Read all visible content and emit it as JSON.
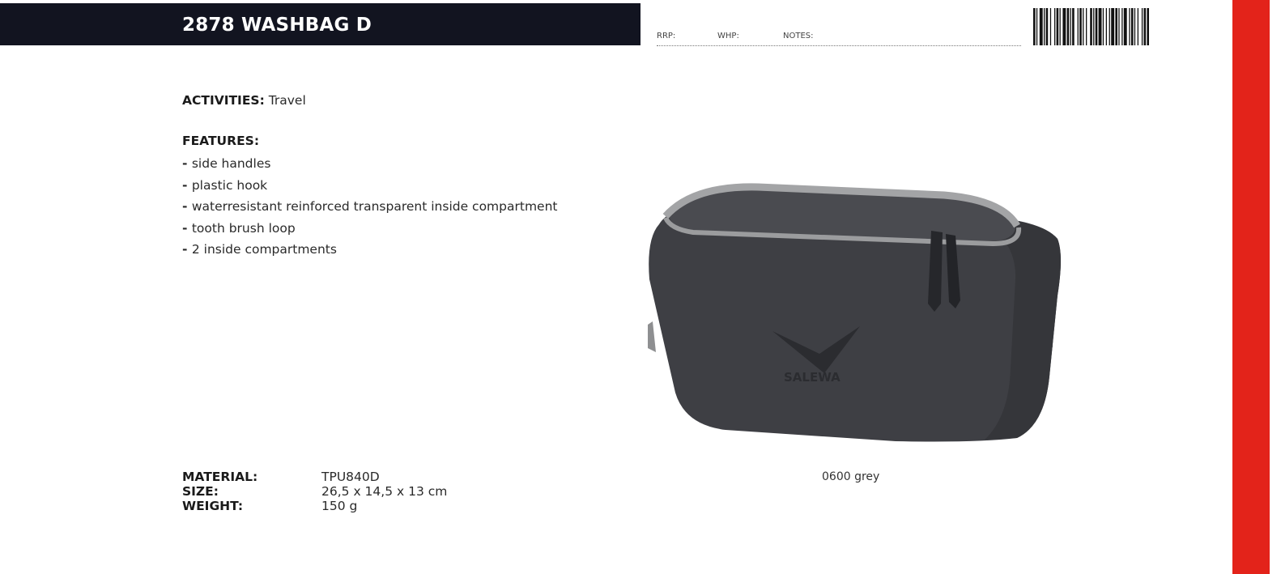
{
  "header": {
    "title": "2878 WASHBAG D"
  },
  "pricing": {
    "rrp_label": "RRP:",
    "whp_label": "WHP:",
    "notes_label": "NOTES:"
  },
  "activities": {
    "label": "ACTIVITIES:",
    "value": "Travel"
  },
  "features": {
    "label": "FEATURES:",
    "items": [
      "side handles",
      "plastic hook",
      "waterresistant reinforced transparent inside compartment",
      "tooth brush loop",
      "2 inside compartments"
    ]
  },
  "specs": {
    "material": {
      "label": "MATERIAL:",
      "value": "TPU840D"
    },
    "size": {
      "label": "SIZE:",
      "value": "26,5 x 14,5 x 13 cm"
    },
    "weight": {
      "label": "WEIGHT:",
      "value": "150 g"
    }
  },
  "product": {
    "brand_mark": "SALEWA",
    "color_caption": "0600 grey"
  },
  "colors": {
    "header_bg": "#121420",
    "accent_red": "#e3231a",
    "bag_body": "#3e3f44",
    "bag_trim": "#9b9c9e"
  }
}
